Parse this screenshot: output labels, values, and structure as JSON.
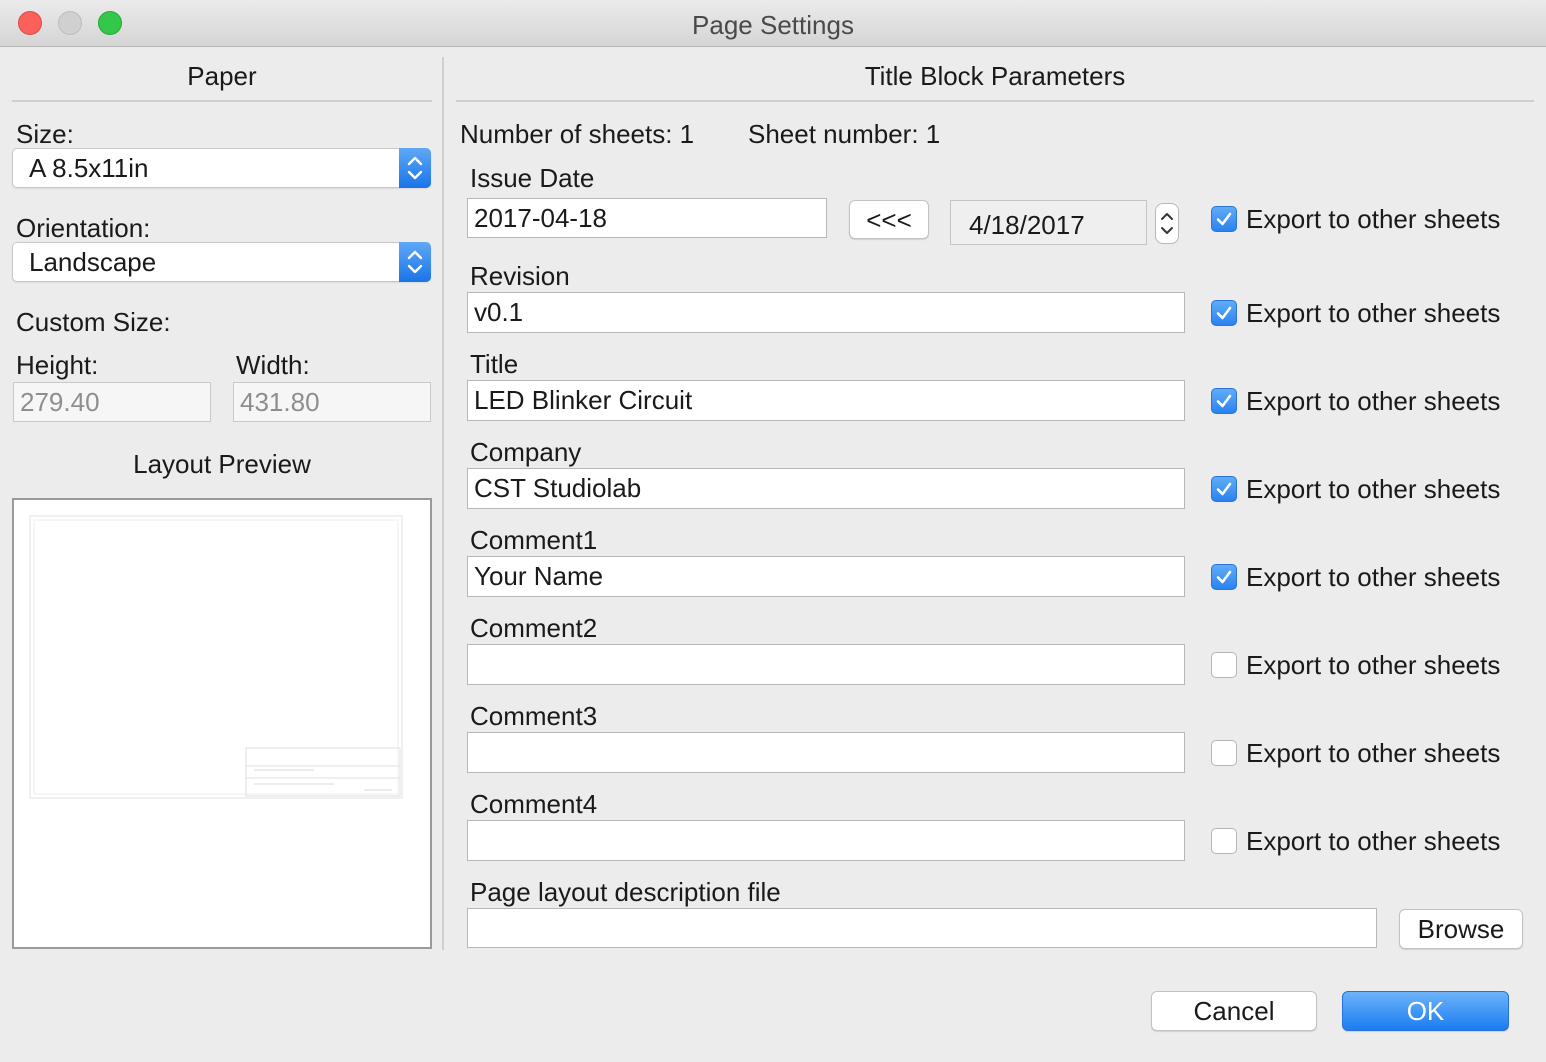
{
  "window": {
    "title": "Page Settings"
  },
  "paper": {
    "header": "Paper",
    "size_label": "Size:",
    "size_value": "A 8.5x11in",
    "orientation_label": "Orientation:",
    "orientation_value": "Landscape",
    "custom_size_label": "Custom Size:",
    "height_label": "Height:",
    "height_value": "279.40",
    "width_label": "Width:",
    "width_value": "431.80",
    "preview_label": "Layout Preview"
  },
  "title_block": {
    "header": "Title Block Parameters",
    "num_sheets": "Number of sheets: 1",
    "sheet_number": "Sheet number: 1",
    "issue_date_label": "Issue Date",
    "issue_date_value": "2017-04-18",
    "copy_button": "<<<",
    "date_picker_value": "4/18/2017",
    "export_label": "Export to other sheets",
    "fields": [
      {
        "label": "Revision",
        "value": "v0.1",
        "export": true
      },
      {
        "label": "Title",
        "value": "LED Blinker Circuit",
        "export": true
      },
      {
        "label": "Company",
        "value": "CST Studiolab",
        "export": true
      },
      {
        "label": "Comment1",
        "value": "Your Name",
        "export": true
      },
      {
        "label": "Comment2",
        "value": "",
        "export": false
      },
      {
        "label": "Comment3",
        "value": "",
        "export": false
      },
      {
        "label": "Comment4",
        "value": "",
        "export": false
      }
    ],
    "issue_date_export": true,
    "layout_file_label": "Page layout description file",
    "layout_file_value": "",
    "browse_button": "Browse"
  },
  "footer": {
    "cancel": "Cancel",
    "ok": "OK"
  },
  "colors": {
    "accent": "#1b7cf0",
    "window_bg": "#ececec"
  }
}
